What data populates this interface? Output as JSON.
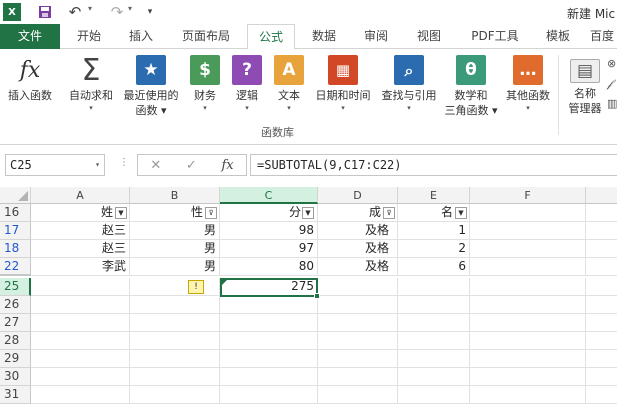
{
  "app": {
    "logo": "X",
    "title": "新建 Mic"
  },
  "qat": {
    "save": "save-icon",
    "undo": "undo-icon",
    "redo": "redo-icon",
    "customize": "customize-icon"
  },
  "tabs": [
    "文件",
    "开始",
    "插入",
    "页面布局",
    "公式",
    "数据",
    "审阅",
    "视图",
    "PDF工具",
    "模板",
    "百度"
  ],
  "ribbon": {
    "group_label": "函数库",
    "buttons": [
      {
        "label1": "插入函数",
        "label2": "",
        "icon": "fx-icon",
        "glyph": "fx",
        "color": "#ffffff"
      },
      {
        "label1": "自动求和",
        "label2": "",
        "icon": "sigma-icon",
        "glyph": "Σ",
        "color": "#ffffff"
      },
      {
        "label1": "最近使用的",
        "label2": "函数",
        "icon": "star-icon",
        "glyph": "★",
        "color": "#2b6cb0"
      },
      {
        "label1": "财务",
        "label2": "",
        "icon": "coins-icon",
        "glyph": "$",
        "color": "#4a9a5a"
      },
      {
        "label1": "逻辑",
        "label2": "",
        "icon": "question-icon",
        "glyph": "?",
        "color": "#8e4bb3"
      },
      {
        "label1": "文本",
        "label2": "",
        "icon": "text-a-icon",
        "glyph": "A",
        "color": "#e8a33d"
      },
      {
        "label1": "日期和时间",
        "label2": "",
        "icon": "calendar-icon",
        "glyph": "▦",
        "color": "#d24726"
      },
      {
        "label1": "查找与引用",
        "label2": "",
        "icon": "magnifier-icon",
        "glyph": "⌕",
        "color": "#2b6cb0"
      },
      {
        "label1": "数学和",
        "label2": "三角函数",
        "icon": "theta-icon",
        "glyph": "θ",
        "color": "#3a9a7a"
      },
      {
        "label1": "其他函数",
        "label2": "",
        "icon": "more-icon",
        "glyph": "…",
        "color": "#e06b2d"
      },
      {
        "label1": "名称",
        "label2": "管理器",
        "icon": "name-manager-icon",
        "glyph": "▤",
        "color": "#666666"
      }
    ]
  },
  "formula_bar": {
    "name_box": "C25",
    "cancel": "✕",
    "enter": "✓",
    "fx": "fx",
    "formula": "=SUBTOTAL(9,C17:C22)"
  },
  "sheet": {
    "columns": [
      "A",
      "B",
      "C",
      "D",
      "E",
      "F"
    ],
    "headers": {
      "a": "姓",
      "b": "性",
      "c": "分",
      "d": "成",
      "e": "名"
    },
    "rows": [
      {
        "num": "16"
      },
      {
        "num": "17",
        "a": "赵三",
        "b": "男",
        "c": "98",
        "d": "及格",
        "e": "1"
      },
      {
        "num": "18",
        "a": "赵三",
        "b": "男",
        "c": "97",
        "d": "及格",
        "e": "2"
      },
      {
        "num": "22",
        "a": "李武",
        "b": "男",
        "c": "80",
        "d": "及格",
        "e": "6"
      },
      {
        "num": "25",
        "c": "275"
      },
      {
        "num": "26"
      },
      {
        "num": "27"
      },
      {
        "num": "28"
      },
      {
        "num": "29"
      },
      {
        "num": "30"
      },
      {
        "num": "31"
      }
    ]
  }
}
